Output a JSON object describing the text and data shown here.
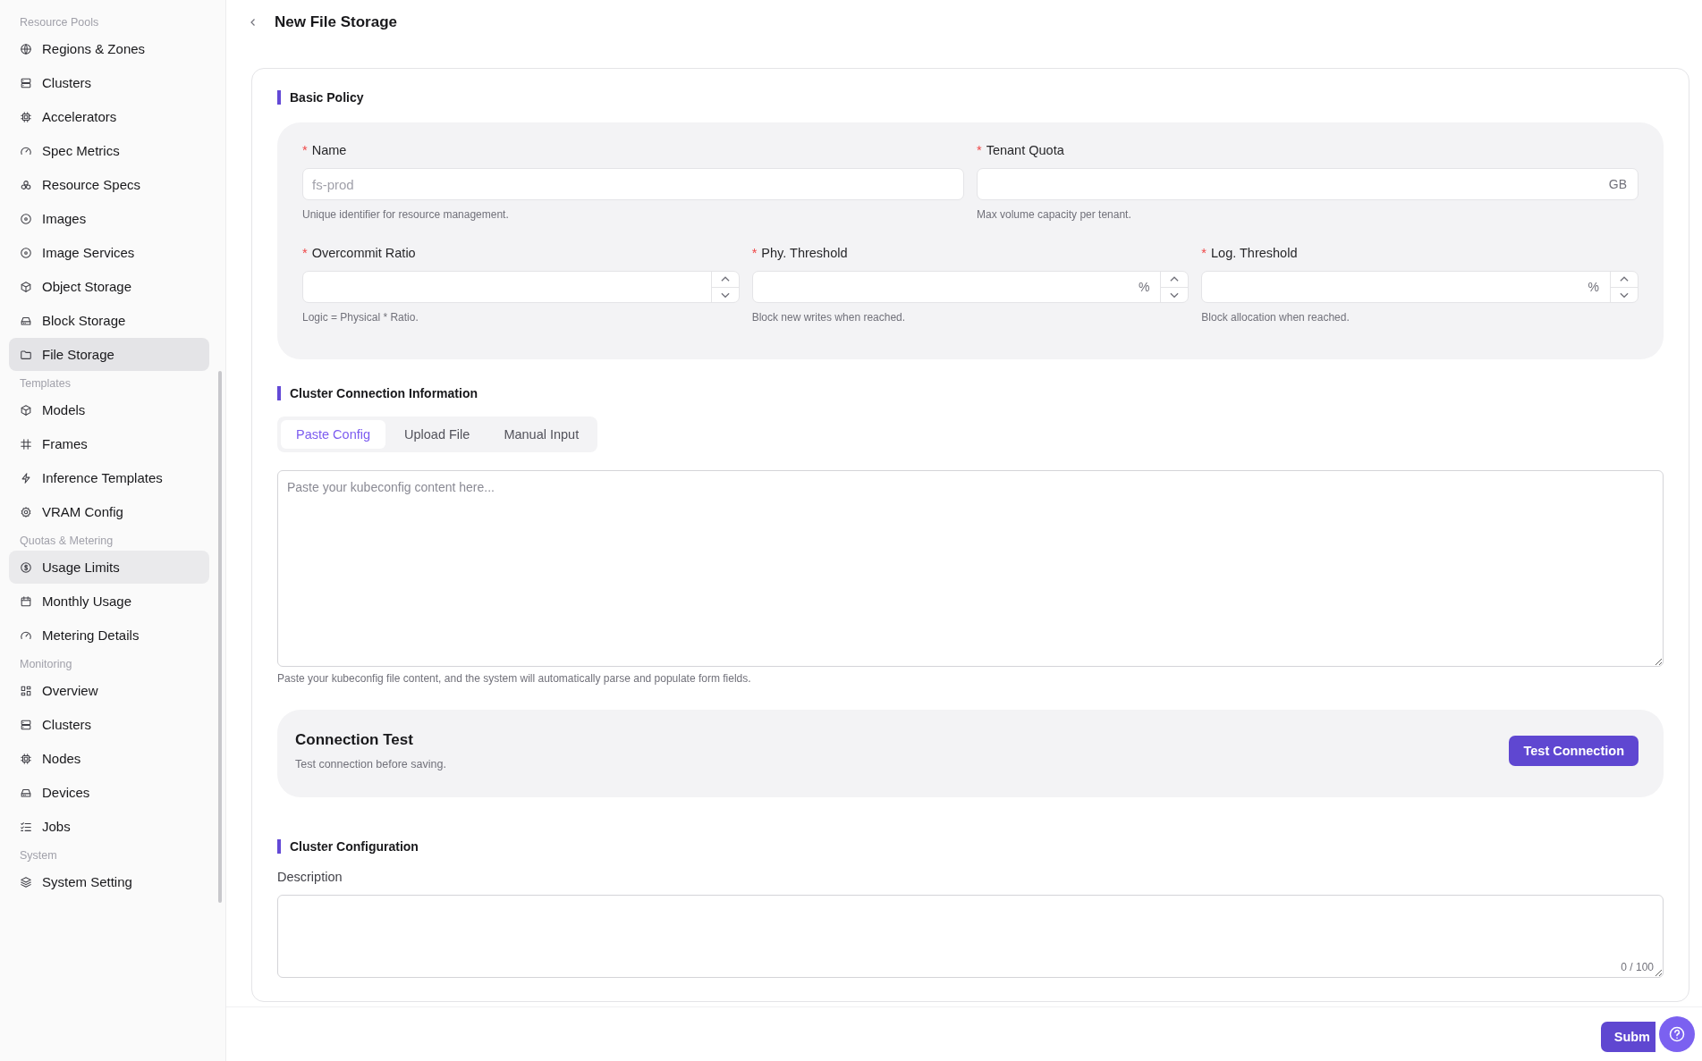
{
  "sidebar": {
    "groups": [
      {
        "title": "Resource Pools",
        "items": [
          {
            "label": "Regions & Zones",
            "selected": false
          },
          {
            "label": "Clusters",
            "selected": false
          },
          {
            "label": "Accelerators",
            "selected": false
          },
          {
            "label": "Spec Metrics",
            "selected": false
          },
          {
            "label": "Resource Specs",
            "selected": false
          },
          {
            "label": "Images",
            "selected": false
          },
          {
            "label": "Image Services",
            "selected": false
          },
          {
            "label": "Object Storage",
            "selected": false
          },
          {
            "label": "Block Storage",
            "selected": false
          },
          {
            "label": "File Storage",
            "selected": true
          }
        ]
      },
      {
        "title": "Templates",
        "items": [
          {
            "label": "Models",
            "selected": false
          },
          {
            "label": "Frames",
            "selected": false
          },
          {
            "label": "Inference Templates",
            "selected": false
          },
          {
            "label": "VRAM Config",
            "selected": false
          }
        ]
      },
      {
        "title": "Quotas & Metering",
        "items": [
          {
            "label": "Usage Limits",
            "selected": false,
            "hovered": true
          },
          {
            "label": "Monthly Usage",
            "selected": false
          },
          {
            "label": "Metering Details",
            "selected": false
          }
        ]
      },
      {
        "title": "Monitoring",
        "items": [
          {
            "label": "Overview",
            "selected": false
          },
          {
            "label": "Clusters",
            "selected": false
          },
          {
            "label": "Nodes",
            "selected": false
          },
          {
            "label": "Devices",
            "selected": false
          },
          {
            "label": "Jobs",
            "selected": false
          }
        ]
      },
      {
        "title": "System",
        "items": [
          {
            "label": "System Setting",
            "selected": false
          }
        ]
      }
    ]
  },
  "page_title": "New File Storage",
  "basic_policy": {
    "title": "Basic Policy",
    "rows": [
      [
        {
          "label": "Name",
          "required_mark": "*",
          "kind": "text",
          "placeholder": "fs-prod",
          "hint": "Unique identifier for resource management."
        },
        {
          "label": "Tenant Quota",
          "required_mark": "*",
          "kind": "text",
          "suffix": "GB",
          "hint": "Max volume capacity per tenant."
        }
      ],
      [
        {
          "label": "Overcommit Ratio",
          "required_mark": "*",
          "kind": "number",
          "hint": "Logic = Physical * Ratio."
        },
        {
          "label": "Phy. Threshold",
          "required_mark": "*",
          "kind": "number",
          "suffix": "%",
          "hint": "Block new writes when reached."
        },
        {
          "label": "Log. Threshold",
          "required_mark": "*",
          "kind": "number",
          "suffix": "%",
          "hint": "Block allocation when reached."
        }
      ]
    ]
  },
  "cluster_connection": {
    "title": "Cluster Connection Information",
    "tabs": [
      {
        "label": "Paste Config",
        "selected": true
      },
      {
        "label": "Upload File",
        "selected": false
      },
      {
        "label": "Manual Input",
        "selected": false
      }
    ],
    "config_placeholder": "Paste your kubeconfig content here...",
    "hint": "Paste your kubeconfig file content, and the system will automatically parse and populate form fields.",
    "connection_test": {
      "title": "Connection Test",
      "subtitle": "Test connection before saving.",
      "button": "Test Connection"
    }
  },
  "cluster_configuration": {
    "title": "Cluster Configuration",
    "description_label": "Description",
    "counter": "0 / 100"
  },
  "footer": {
    "submit": "Subm"
  }
}
